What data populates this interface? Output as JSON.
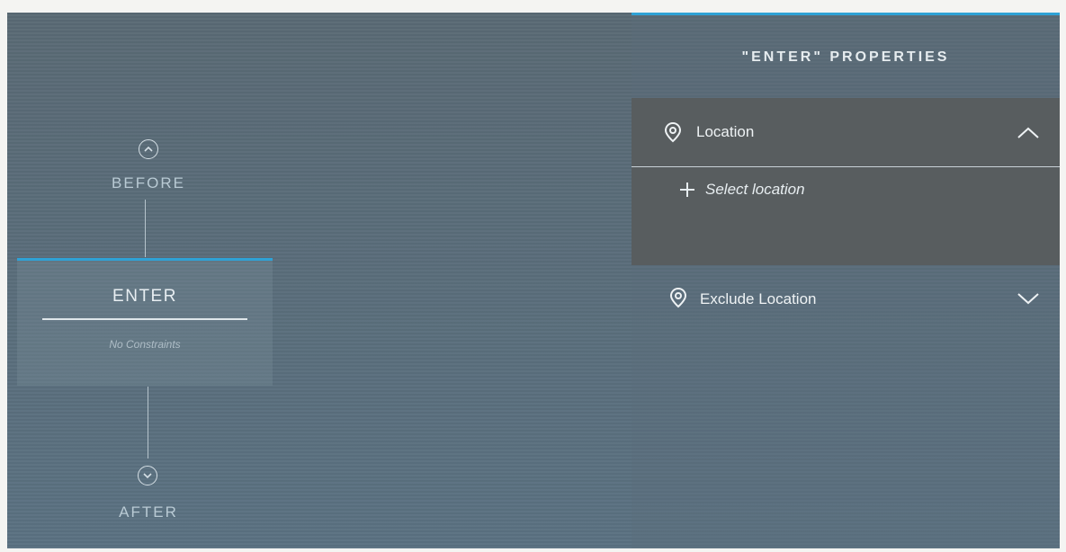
{
  "flow": {
    "before_label": "BEFORE",
    "after_label": "AFTER",
    "step": {
      "title": "ENTER",
      "subtitle": "No Constraints"
    }
  },
  "properties": {
    "title": "\"ENTER\" PROPERTIES",
    "sections": [
      {
        "label": "Location",
        "icon": "location-pin-icon",
        "expanded": true,
        "add_action_label": "Select location"
      },
      {
        "label": "Exclude Location",
        "icon": "location-pin-icon",
        "expanded": false
      }
    ]
  },
  "colors": {
    "accent": "#2fa2d6",
    "panel_dark": "#585d5f",
    "text_light": "#e8eef2"
  }
}
